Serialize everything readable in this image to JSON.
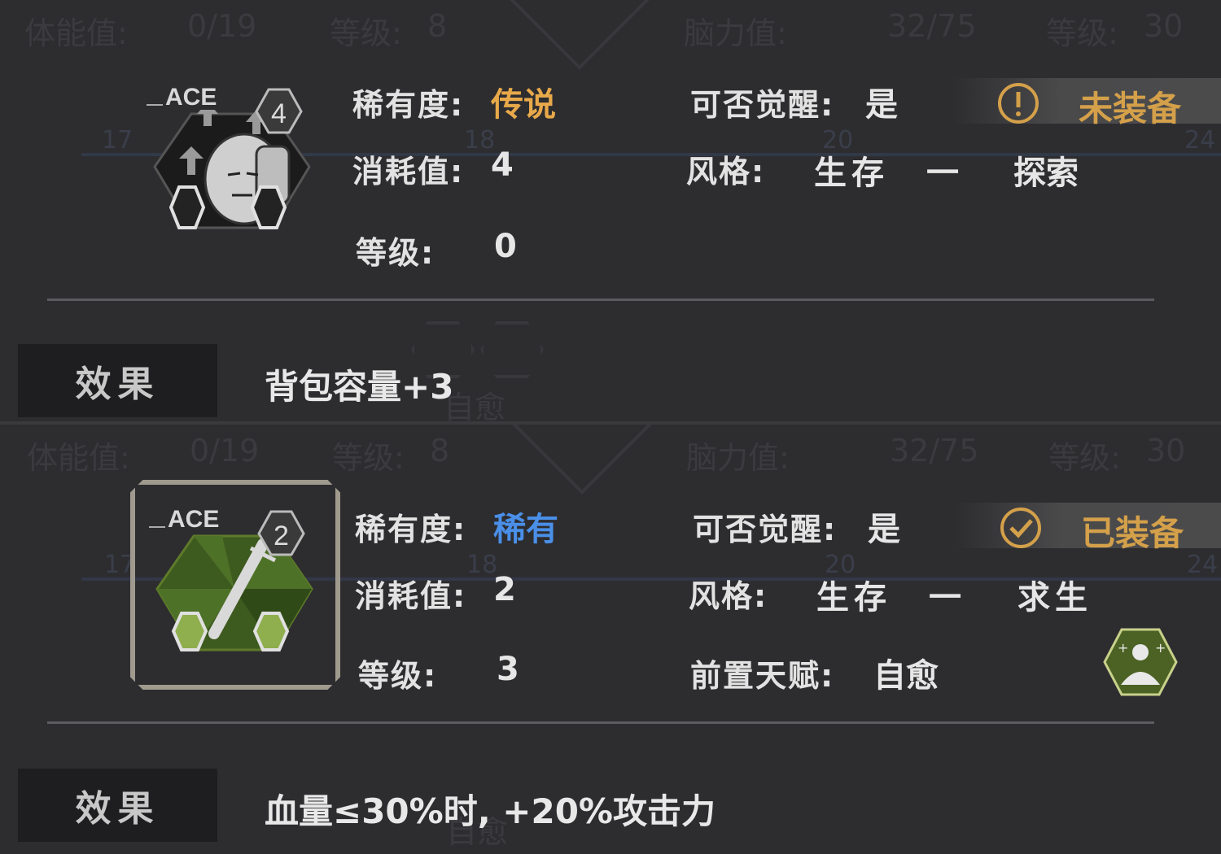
{
  "cards": [
    {
      "icon_name": "backpack-man-icon",
      "icon_badge": "ACE",
      "cost_badge": "4",
      "rarity_label": "稀有度:",
      "rarity_value": "传说",
      "rarity_color": "#e8a94a",
      "awaken_label": "可否觉醒:",
      "awaken_value": "是",
      "status_icon": "warning-circle-icon",
      "status_text": "未装备",
      "cost_label": "消耗值:",
      "cost_value": "4",
      "style_label": "风格:",
      "style_value_1": "生存",
      "style_sep": "一",
      "style_value_2": "探索",
      "level_label": "等级:",
      "level_value": "0",
      "effect_tag": "效果",
      "effect_text": "背包容量+3"
    },
    {
      "icon_name": "syringe-icon",
      "icon_badge": "ACE",
      "cost_badge": "2",
      "rarity_label": "稀有度:",
      "rarity_value": "稀有",
      "rarity_color": "#4a8fe8",
      "awaken_label": "可否觉醒:",
      "awaken_value": "是",
      "status_icon": "check-circle-icon",
      "status_text": "已装备",
      "cost_label": "消耗值:",
      "cost_value": "2",
      "style_label": "风格:",
      "style_value_1": "生存",
      "style_sep": "一",
      "style_value_2": "求生",
      "level_label": "等级:",
      "level_value": "3",
      "prereq_label": "前置天赋:",
      "prereq_value": "自愈",
      "prereq_icon": "self-heal-talent-icon",
      "effect_tag": "效果",
      "effect_text": "血量≤30%时, +20%攻击力"
    }
  ],
  "background_ghost": {
    "stat_1_label": "体能值:",
    "stat_1_value": "0/19",
    "level_1_label": "等级:",
    "level_1_value": "8",
    "stat_2_label": "脑力值:",
    "stat_2_value": "32/75",
    "level_2_label": "等级:",
    "level_2_value": "30",
    "nodes": [
      "17",
      "18",
      "20",
      "24"
    ],
    "talent_name": "自愈"
  }
}
